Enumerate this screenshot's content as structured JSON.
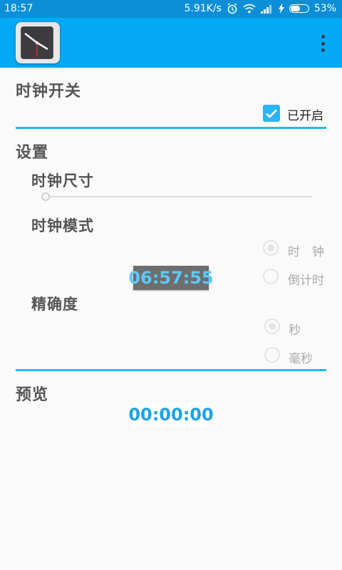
{
  "status_bar": {
    "time": "18:57",
    "net_speed": "5.91K/s",
    "battery": "53%",
    "icons": [
      "alarm-icon",
      "wifi-icon",
      "signal-icon",
      "charging-icon",
      "battery-icon"
    ]
  },
  "app_bar": {
    "icon": "clock-app-icon",
    "menu_icon": "overflow-menu-icon",
    "color": "#03a9f4"
  },
  "clock_switch": {
    "title": "时钟开关",
    "checkbox_label": "已开启",
    "checked": true
  },
  "settings": {
    "title": "设置",
    "size_label": "时钟尺寸",
    "size_value": 0,
    "mode_label": "时钟模式",
    "mode_options": [
      "时　钟",
      "倒计时"
    ],
    "mode_selected": "时　钟",
    "clock_display": "06:57:55",
    "precision_label": "精确度",
    "precision_options": [
      "秒",
      "毫秒"
    ],
    "precision_selected": "秒"
  },
  "preview": {
    "title": "预览",
    "display": "00:00:00"
  },
  "colors": {
    "accent": "#29b6f6",
    "statusbar": "#0c8fd8"
  }
}
